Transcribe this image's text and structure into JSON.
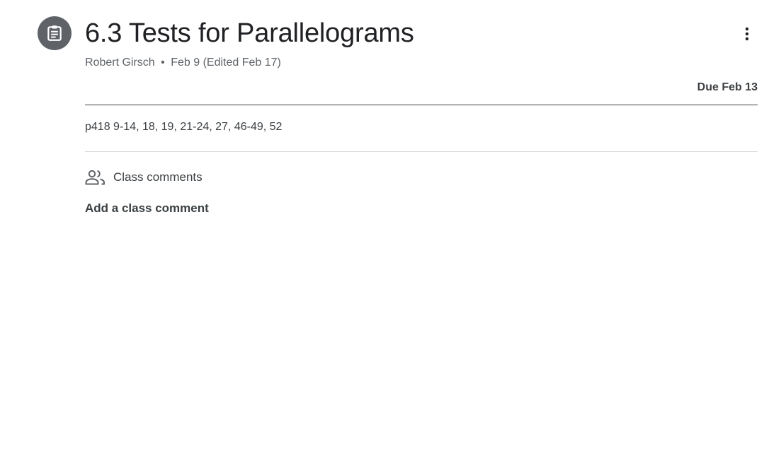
{
  "assignment": {
    "icon": "assignment-icon",
    "title": "6.3 Tests for Parallelograms",
    "author": "Robert Girsch",
    "separator": "•",
    "posted": "Feb 9 (Edited Feb 17)",
    "due": "Due Feb 13",
    "instructions": "p418 9-14, 18, 19, 21-24, 27, 46-49, 52"
  },
  "comments": {
    "icon": "people-icon",
    "header": "Class comments",
    "add_label": "Add a class comment"
  },
  "menu": {
    "icon": "more-vert-icon"
  },
  "colors": {
    "icon_circle": "#5f6368",
    "title": "#202124",
    "text": "#3c4043",
    "muted": "#5f6368",
    "divider": "#dadce0"
  }
}
